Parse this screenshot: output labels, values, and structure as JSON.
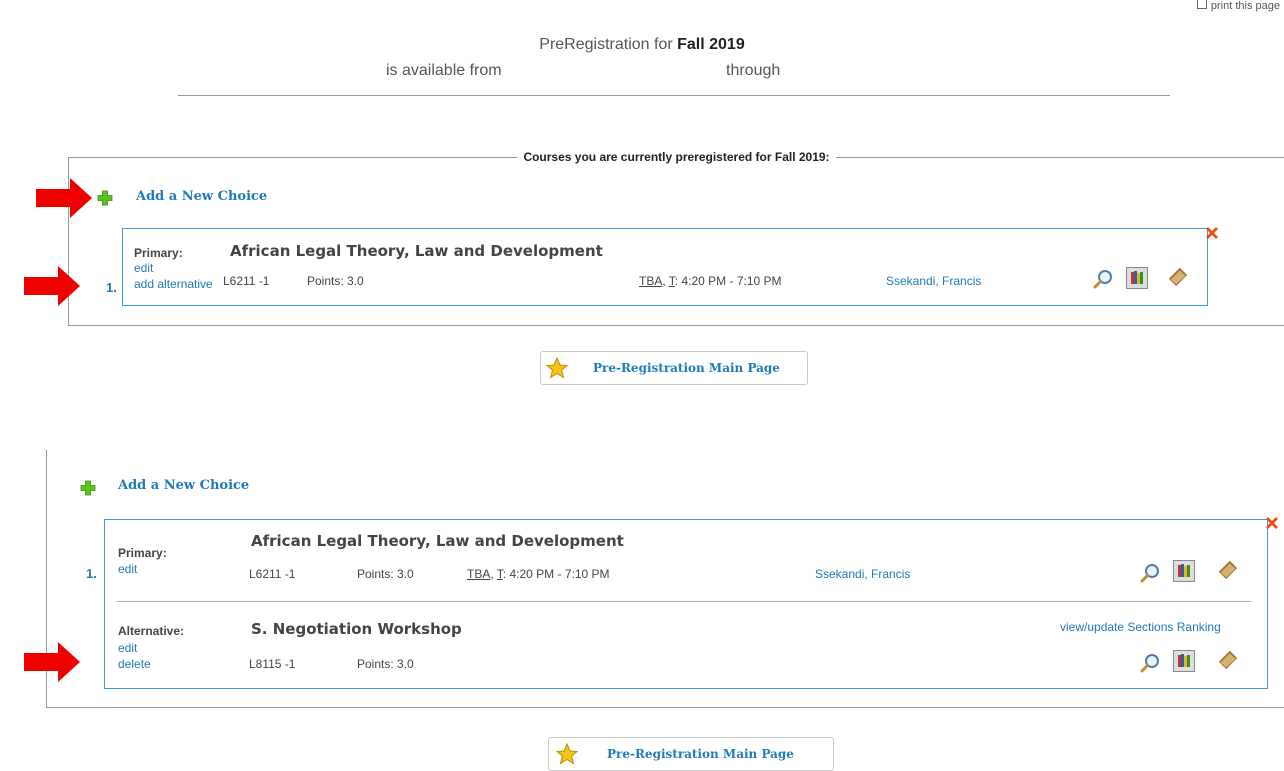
{
  "print": {
    "label": "print this page"
  },
  "header": {
    "prereg_prefix": "PreRegistration for ",
    "term": "Fall 2019",
    "available_from": "is available from",
    "through": "through"
  },
  "top": {
    "legend": "Courses you are currently preregistered for Fall 2019:",
    "add_new_choice": "Add a New Choice",
    "choice": {
      "number": "1.",
      "primary_label": "Primary:",
      "edit": "edit",
      "add_alternative": "add alternative",
      "title": "African Legal Theory, Law and Development",
      "code": "L6211 -1",
      "points": "Points: 3.0",
      "tba": "TBA",
      "day": "T",
      "time": ": 4:20 PM - 7:10 PM",
      "instructor": "Ssekandi, Francis"
    },
    "main_page_button": "Pre-Registration Main Page"
  },
  "bottom": {
    "add_new_choice": "Add a New Choice",
    "choice": {
      "number": "1.",
      "primary_label": "Primary:",
      "edit": "edit",
      "title": "African Legal Theory, Law and Development",
      "code": "L6211 -1",
      "points": "Points: 3.0",
      "tba": "TBA",
      "day": "T",
      "time": ": 4:20 PM - 7:10 PM",
      "instructor": "Ssekandi, Francis"
    },
    "alternative": {
      "label": "Alternative:",
      "edit": "edit",
      "delete": "delete",
      "title": "S. Negotiation Workshop",
      "code": "L8115 -1",
      "points": "Points: 3.0",
      "ranking_link": "view/update Sections Ranking"
    },
    "main_page_button": "Pre-Registration Main Page"
  },
  "colors": {
    "accent": "#1f7ab8",
    "card_border": "#3a9ad9",
    "arrow": "#ee0000",
    "remove": "#e8501a",
    "plus": "#5cc21e"
  },
  "icons": [
    "print-icon",
    "red-arrow-annotation",
    "add-plus-icon",
    "remove-x-icon",
    "magnifier-icon",
    "books-icon",
    "book-icon",
    "star-icon"
  ]
}
